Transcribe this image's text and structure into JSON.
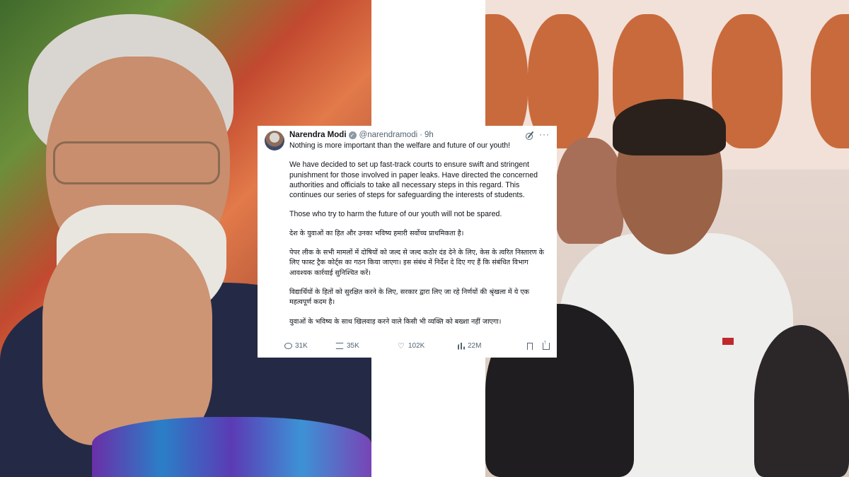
{
  "tweet": {
    "author_name": "Narendra Modi",
    "handle": "@narendramodi",
    "separator": "·",
    "time": "9h",
    "more_glyph": "···",
    "paragraphs_en": [
      "Nothing is more important than the welfare and future of our youth!",
      "We have decided to set up fast-track courts to ensure swift and stringent punishment for those involved in paper leaks. Have directed the concerned authorities and officials to take all necessary steps in this regard. This continues our series of steps for safeguarding the interests of students.",
      "Those who try to harm the future of our youth will not be spared."
    ],
    "paragraphs_hi": [
      "देश के युवाओं का हित और उनका भविष्य हमारी सर्वोच्च प्राथमिकता है।",
      "पेपर लीक के सभी मामलों में दोषियों को जल्द से जल्द कठोर दंड देने के लिए, केस के त्वरित निस्तारण के लिए फास्ट ट्रैक कोर्ट्स का गठन किया जाएगा। इस संबंध में निर्देश दे दिए गए हैं कि संबंधित विभाग आवश्यक कार्रवाई सुनिश्चित करें।",
      "विद्यार्थियों के हितों को सुरक्षित करने के लिए, सरकार द्वारा लिए जा रहे निर्णयों की श्रृंखला में ये एक महत्वपूर्ण कदम है।",
      "युवाओं के भविष्य के साथ खिलवाड़ करने वाले किसी भी व्यक्ति को बख्शा नहीं जाएगा।"
    ],
    "stats": {
      "replies": "31K",
      "reposts": "35K",
      "likes": "102K",
      "views": "22M"
    }
  },
  "icons": [
    "verified-badge-icon",
    "grok-icon",
    "more-icon",
    "reply-icon",
    "repost-icon",
    "like-icon",
    "views-icon",
    "bookmark-icon",
    "share-icon"
  ],
  "colors": {
    "text": "#0f1419",
    "muted": "#536471",
    "card_bg": "#ffffff"
  }
}
